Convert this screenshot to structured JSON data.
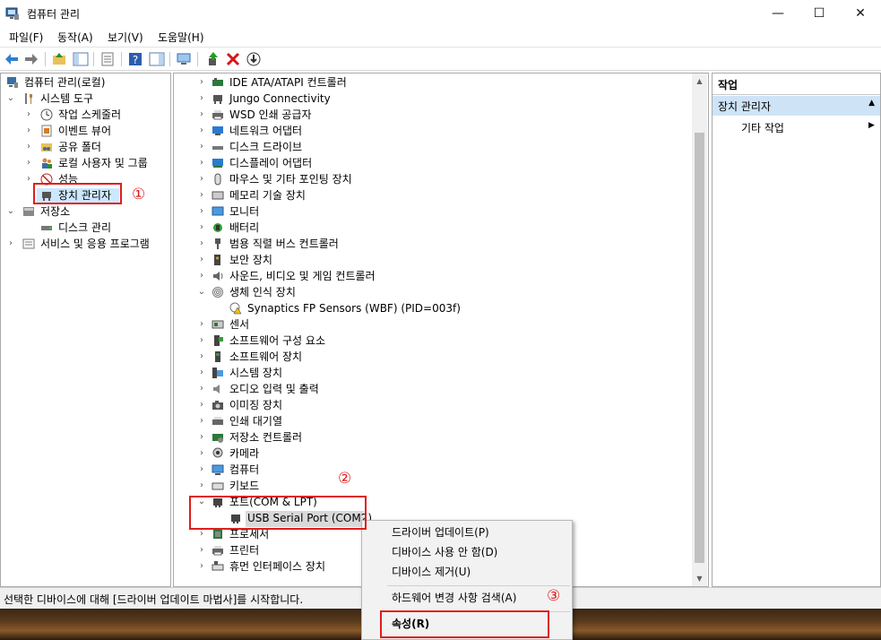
{
  "window": {
    "title": "컴퓨터 관리",
    "controls": [
      "—",
      "☐",
      "✕"
    ]
  },
  "menu": [
    "파일(F)",
    "동작(A)",
    "보기(V)",
    "도움말(H)"
  ],
  "left_tree": [
    {
      "label": "컴퓨터 관리(로컬)",
      "icon": "computer-management-icon"
    },
    {
      "label": "시스템 도구",
      "icon": "tools-icon"
    },
    {
      "label": "작업 스케줄러",
      "icon": "clock-icon"
    },
    {
      "label": "이벤트 뷰어",
      "icon": "event-viewer-icon"
    },
    {
      "label": "공유 폴더",
      "icon": "shared-folder-icon"
    },
    {
      "label": "로컬 사용자 및 그룹",
      "icon": "users-icon"
    },
    {
      "label": "성능",
      "icon": "performance-icon"
    },
    {
      "label": "장치 관리자",
      "icon": "device-manager-icon"
    },
    {
      "label": "저장소",
      "icon": "storage-icon"
    },
    {
      "label": "디스크 관리",
      "icon": "disk-icon"
    },
    {
      "label": "서비스 및 응용 프로그램",
      "icon": "services-icon"
    }
  ],
  "device_tree": [
    {
      "label": "IDE ATA/ATAPI 컨트롤러",
      "icon": "ide-controller-icon"
    },
    {
      "label": "Jungo Connectivity",
      "icon": "device-icon"
    },
    {
      "label": "WSD 인쇄 공급자",
      "icon": "printer-icon"
    },
    {
      "label": "네트워크 어댑터",
      "icon": "network-adapter-icon"
    },
    {
      "label": "디스크 드라이브",
      "icon": "disk-drive-icon"
    },
    {
      "label": "디스플레이 어댑터",
      "icon": "display-adapter-icon"
    },
    {
      "label": "마우스 및 기타 포인팅 장치",
      "icon": "mouse-icon"
    },
    {
      "label": "메모리 기술 장치",
      "icon": "memory-icon"
    },
    {
      "label": "모니터",
      "icon": "monitor-icon"
    },
    {
      "label": "배터리",
      "icon": "battery-icon"
    },
    {
      "label": "범용 직렬 버스 컨트롤러",
      "icon": "usb-icon"
    },
    {
      "label": "보안 장치",
      "icon": "security-device-icon"
    },
    {
      "label": "사운드, 비디오 및 게임 컨트롤러",
      "icon": "sound-icon"
    },
    {
      "label": "생체 인식 장치",
      "icon": "biometric-icon"
    },
    {
      "label": "Synaptics FP Sensors (WBF) (PID=003f)",
      "icon": "warning-device-icon"
    },
    {
      "label": "센서",
      "icon": "sensor-icon"
    },
    {
      "label": "소프트웨어 구성 요소",
      "icon": "software-component-icon"
    },
    {
      "label": "소프트웨어 장치",
      "icon": "software-device-icon"
    },
    {
      "label": "시스템 장치",
      "icon": "system-device-icon"
    },
    {
      "label": "오디오 입력 및 출력",
      "icon": "audio-icon"
    },
    {
      "label": "이미징 장치",
      "icon": "camera-icon"
    },
    {
      "label": "인쇄 대기열",
      "icon": "print-queue-icon"
    },
    {
      "label": "저장소 컨트롤러",
      "icon": "storage-controller-icon"
    },
    {
      "label": "카메라",
      "icon": "webcam-icon"
    },
    {
      "label": "컴퓨터",
      "icon": "computer-icon"
    },
    {
      "label": "키보드",
      "icon": "keyboard-icon"
    },
    {
      "label": "포트(COM & LPT)",
      "icon": "port-icon"
    },
    {
      "label": "USB Serial Port (COM2)",
      "icon": "serial-port-icon"
    },
    {
      "label": "프로세서",
      "icon": "processor-icon"
    },
    {
      "label": "프린터",
      "icon": "printer-icon"
    },
    {
      "label": "휴먼 인터페이스 장치",
      "icon": "hid-icon"
    }
  ],
  "actions_pane": {
    "header": "작업",
    "section": "장치 관리자",
    "item": "기타 작업"
  },
  "context_menu": [
    "드라이버 업데이트(P)",
    "디바이스 사용 안 함(D)",
    "디바이스 제거(U)",
    "하드웨어 변경 사항 검색(A)",
    "속성(R)"
  ],
  "status": "선택한 디바이스에 대해 [드라이버 업데이트 마법사]를 시작합니다.",
  "markers": [
    "①",
    "②",
    "③"
  ],
  "colors": {
    "highlight": "#e01d1d",
    "selection": "#cce8ff",
    "action_section": "#cfe3f7"
  }
}
